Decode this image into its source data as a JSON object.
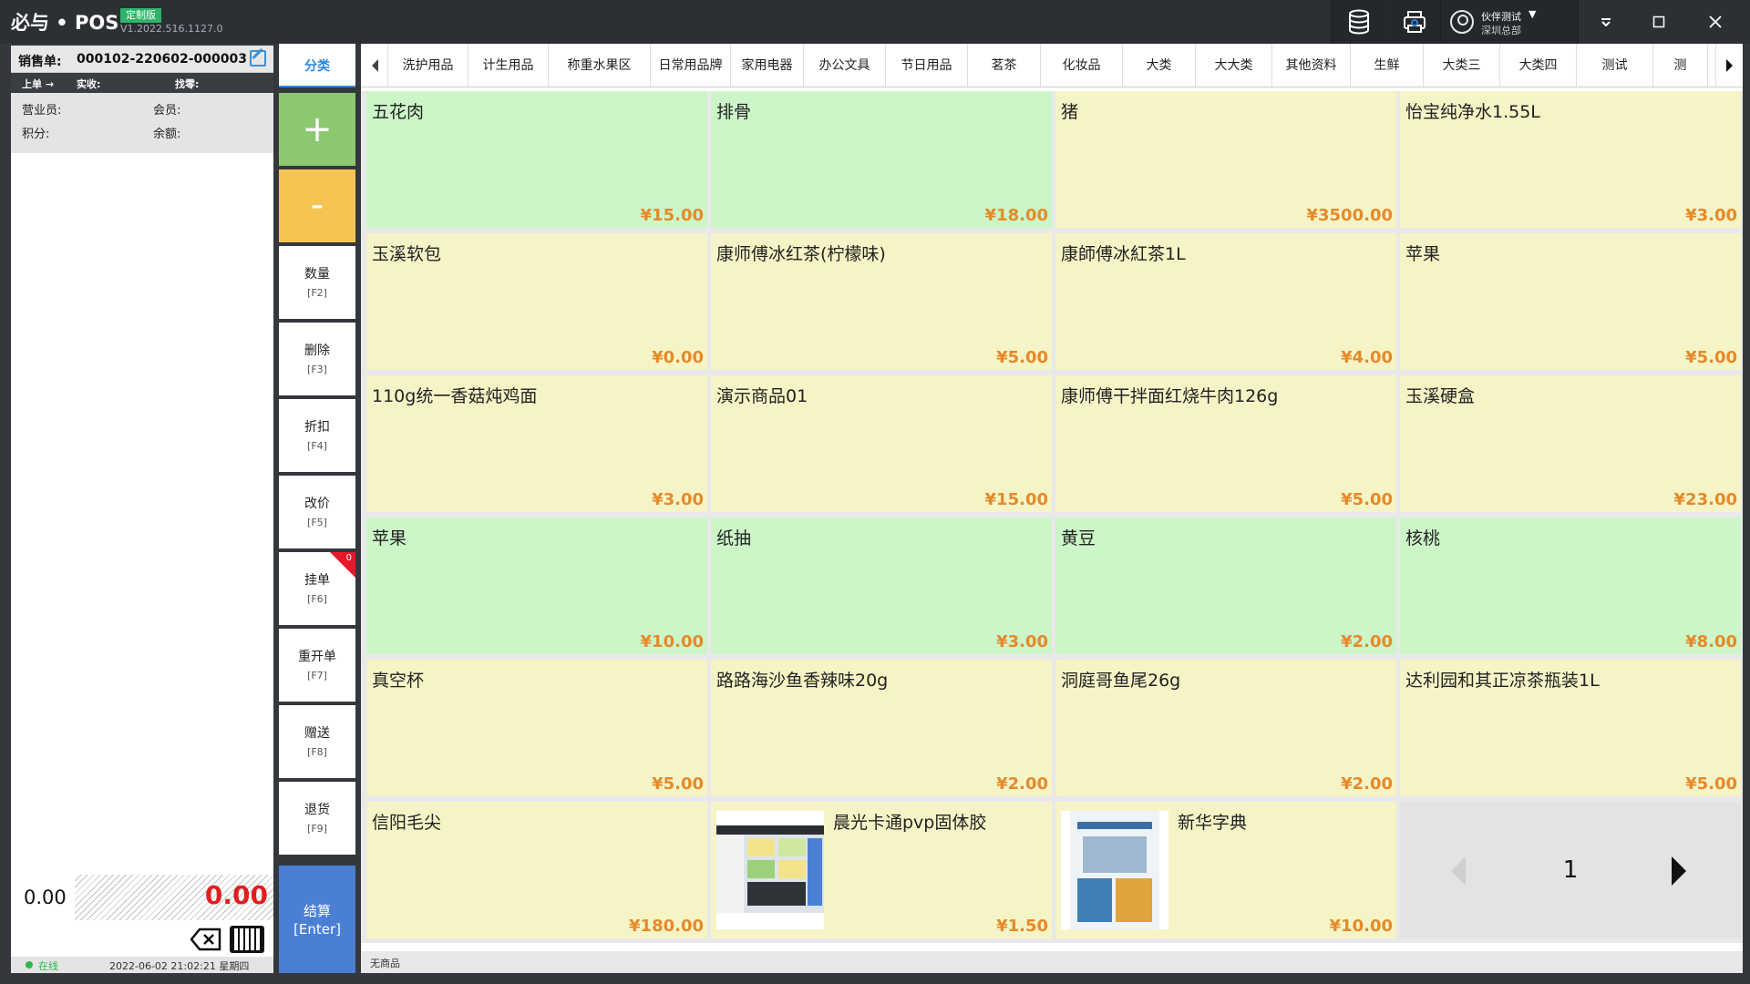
{
  "app": {
    "logo": "必与 • POS",
    "badge": "定制版",
    "version": "V1.2022.516.1127.0"
  },
  "user": {
    "name": "伙伴测试",
    "caret": "▼",
    "dept": "深圳总部"
  },
  "order": {
    "label": "销售单:",
    "number": "000102-220602-000003",
    "prev_order": "上单 →",
    "paid_label": "实收:",
    "change_label": "找零:",
    "clerk_label": "营业员:",
    "member_label": "会员:",
    "points_label": "积分:",
    "balance_label": "余额:",
    "qty_total": "0.00",
    "amount_total": "0.00"
  },
  "status": {
    "online": "在线",
    "datetime": "2022-06-02 21:02:21 星期四"
  },
  "functions": {
    "category": "分类",
    "plus": "+",
    "minus": "-",
    "buttons": [
      {
        "label": "数量",
        "key": "[F2]"
      },
      {
        "label": "删除",
        "key": "[F3]"
      },
      {
        "label": "折扣",
        "key": "[F4]"
      },
      {
        "label": "改价",
        "key": "[F5]"
      },
      {
        "label": "挂单",
        "key": "[F6]",
        "badge": "0"
      },
      {
        "label": "重开单",
        "key": "[F7]"
      },
      {
        "label": "赠送",
        "key": "[F8]"
      },
      {
        "label": "退货",
        "key": "[F9]"
      }
    ],
    "settle": "结算",
    "settle_key": "[Enter]"
  },
  "categories": [
    "洗护用品",
    "计生用品",
    "称重水果区",
    "日常用品牌",
    "家用电器",
    "办公文具",
    "节日用品",
    "茗茶",
    "化妆品",
    "大类",
    "大大类",
    "其他资料",
    "生鲜",
    "大类三",
    "大类四",
    "测试",
    "测"
  ],
  "colors": {
    "green_tile": "#ccf6c8",
    "yellow_tile": "#f6f4c6",
    "price": "#e58a2a",
    "accent": "#2a86d9",
    "settle": "#4a7fd4",
    "total_red": "#e01e1e"
  },
  "products": [
    {
      "name": "五花肉",
      "price": "¥15.00",
      "color": "green"
    },
    {
      "name": "排骨",
      "price": "¥18.00",
      "color": "green"
    },
    {
      "name": "猪",
      "price": "¥3500.00",
      "color": "yellow"
    },
    {
      "name": "怡宝纯净水1.55L",
      "price": "¥3.00",
      "color": "yellow"
    },
    {
      "name": "玉溪软包",
      "price": "¥0.00",
      "color": "yellow"
    },
    {
      "name": "康师傅冰红茶(柠檬味)",
      "price": "¥5.00",
      "color": "yellow"
    },
    {
      "name": "康師傅冰紅茶1L",
      "price": "¥4.00",
      "color": "yellow"
    },
    {
      "name": "苹果",
      "price": "¥5.00",
      "color": "yellow"
    },
    {
      "name": "110g统一香菇炖鸡面",
      "price": "¥3.00",
      "color": "yellow"
    },
    {
      "name": "演示商品01",
      "price": "¥15.00",
      "color": "yellow"
    },
    {
      "name": "康师傅干拌面红烧牛肉126g",
      "price": "¥5.00",
      "color": "yellow"
    },
    {
      "name": "玉溪硬盒",
      "price": "¥23.00",
      "color": "yellow"
    },
    {
      "name": "苹果",
      "price": "¥10.00",
      "color": "green"
    },
    {
      "name": "纸抽",
      "price": "¥3.00",
      "color": "green"
    },
    {
      "name": "黄豆",
      "price": "¥2.00",
      "color": "green"
    },
    {
      "name": "核桃",
      "price": "¥8.00",
      "color": "green"
    },
    {
      "name": "真空杯",
      "price": "¥5.00",
      "color": "yellow"
    },
    {
      "name": "路路海沙鱼香辣味20g",
      "price": "¥2.00",
      "color": "yellow"
    },
    {
      "name": "洞庭哥鱼尾26g",
      "price": "¥2.00",
      "color": "yellow"
    },
    {
      "name": "达利园和其正凉茶瓶装1L",
      "price": "¥5.00",
      "color": "yellow"
    },
    {
      "name": "信阳毛尖",
      "price": "¥180.00",
      "color": "yellow"
    },
    {
      "name": "晨光卡通pvp固体胶",
      "price": "¥1.50",
      "color": "yellow",
      "image": "screenshot-thumb"
    },
    {
      "name": "新华字典",
      "price": "¥10.00",
      "color": "yellow",
      "image": "book-thumb"
    }
  ],
  "pager": {
    "page": "1"
  },
  "footer": {
    "text": "无商品"
  }
}
